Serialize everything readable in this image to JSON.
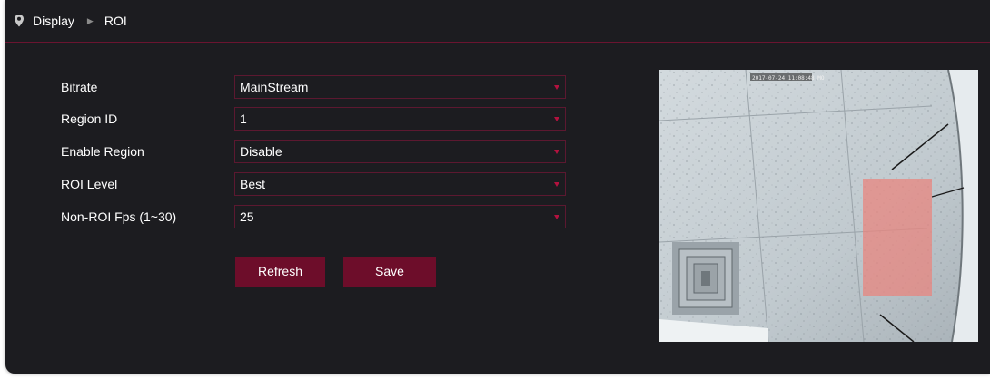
{
  "breadcrumb": {
    "section": "Display",
    "page": "ROI"
  },
  "form": {
    "rows": [
      {
        "label": "Bitrate",
        "value": "MainStream"
      },
      {
        "label": "Region ID",
        "value": "1"
      },
      {
        "label": "Enable Region",
        "value": "Disable"
      },
      {
        "label": "ROI Level",
        "value": "Best"
      },
      {
        "label": "Non-ROI Fps (1~30)",
        "value": "25"
      }
    ]
  },
  "buttons": {
    "refresh": "Refresh",
    "save": "Save"
  },
  "preview": {
    "timestamp": "2017-07-24 11:08:48 MO"
  },
  "colors": {
    "accent": "#6d0d2a",
    "background": "#1c1c20",
    "caret": "#b3123f",
    "roi": "#e8857f"
  },
  "icons": {
    "location": "map-pin-icon",
    "separator": "triangle-right-icon",
    "dropdown": "caret-down-icon"
  }
}
